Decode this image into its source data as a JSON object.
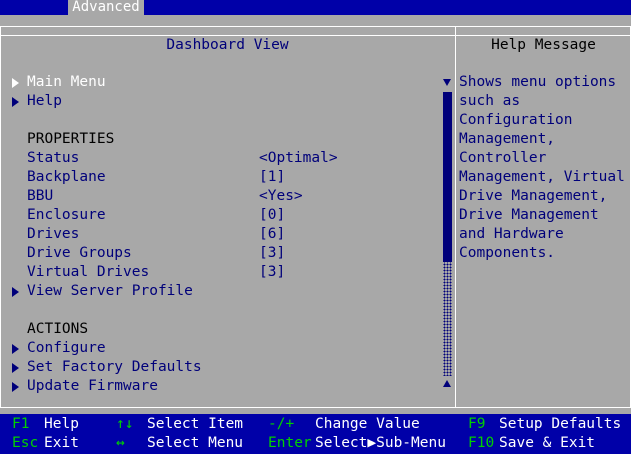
{
  "top_tab": "Advanced",
  "titles": {
    "left": "Dashboard View",
    "right": "Help Message"
  },
  "menu": {
    "main_menu": "Main Menu",
    "help": "Help",
    "properties_header": "PROPERTIES",
    "properties": [
      {
        "label": "Status",
        "value": "<Optimal>"
      },
      {
        "label": "Backplane",
        "value": "[1]"
      },
      {
        "label": "BBU",
        "value": "<Yes>"
      },
      {
        "label": "Enclosure",
        "value": "[0]"
      },
      {
        "label": "Drives",
        "value": "[6]"
      },
      {
        "label": "Drive Groups",
        "value": "[3]"
      },
      {
        "label": "Virtual Drives",
        "value": "[3]"
      }
    ],
    "view_server_profile": "View Server Profile",
    "actions_header": "ACTIONS",
    "actions": [
      "Configure",
      "Set Factory Defaults",
      "Update Firmware"
    ]
  },
  "help_lines": [
    "Shows menu options",
    "such as",
    "Configuration",
    "Management,",
    "Controller",
    "Management, Virtual",
    "Drive Management,",
    "Drive Management",
    "and Hardware",
    "Components."
  ],
  "footer": {
    "f1_key": "F1",
    "f1_desc": "Help",
    "esc_key": "Esc",
    "esc_desc": "Exit",
    "ud_key": "↑↓",
    "ud_desc": "Select Item",
    "lr_key": "↔",
    "lr_desc": "Select Menu",
    "pm_key": "-/+",
    "pm_desc": "Change Value",
    "enter_key": "Enter",
    "enter_desc": "Select▶Sub-Menu",
    "f9_key": "F9",
    "f9_desc": "Setup Defaults",
    "f10_key": "F10",
    "f10_desc": "Save & Exit"
  },
  "colors": {
    "background": "#a8a8a8",
    "bar": "#0000a8",
    "text_blue": "#00007a",
    "key_green": "#00d000"
  }
}
